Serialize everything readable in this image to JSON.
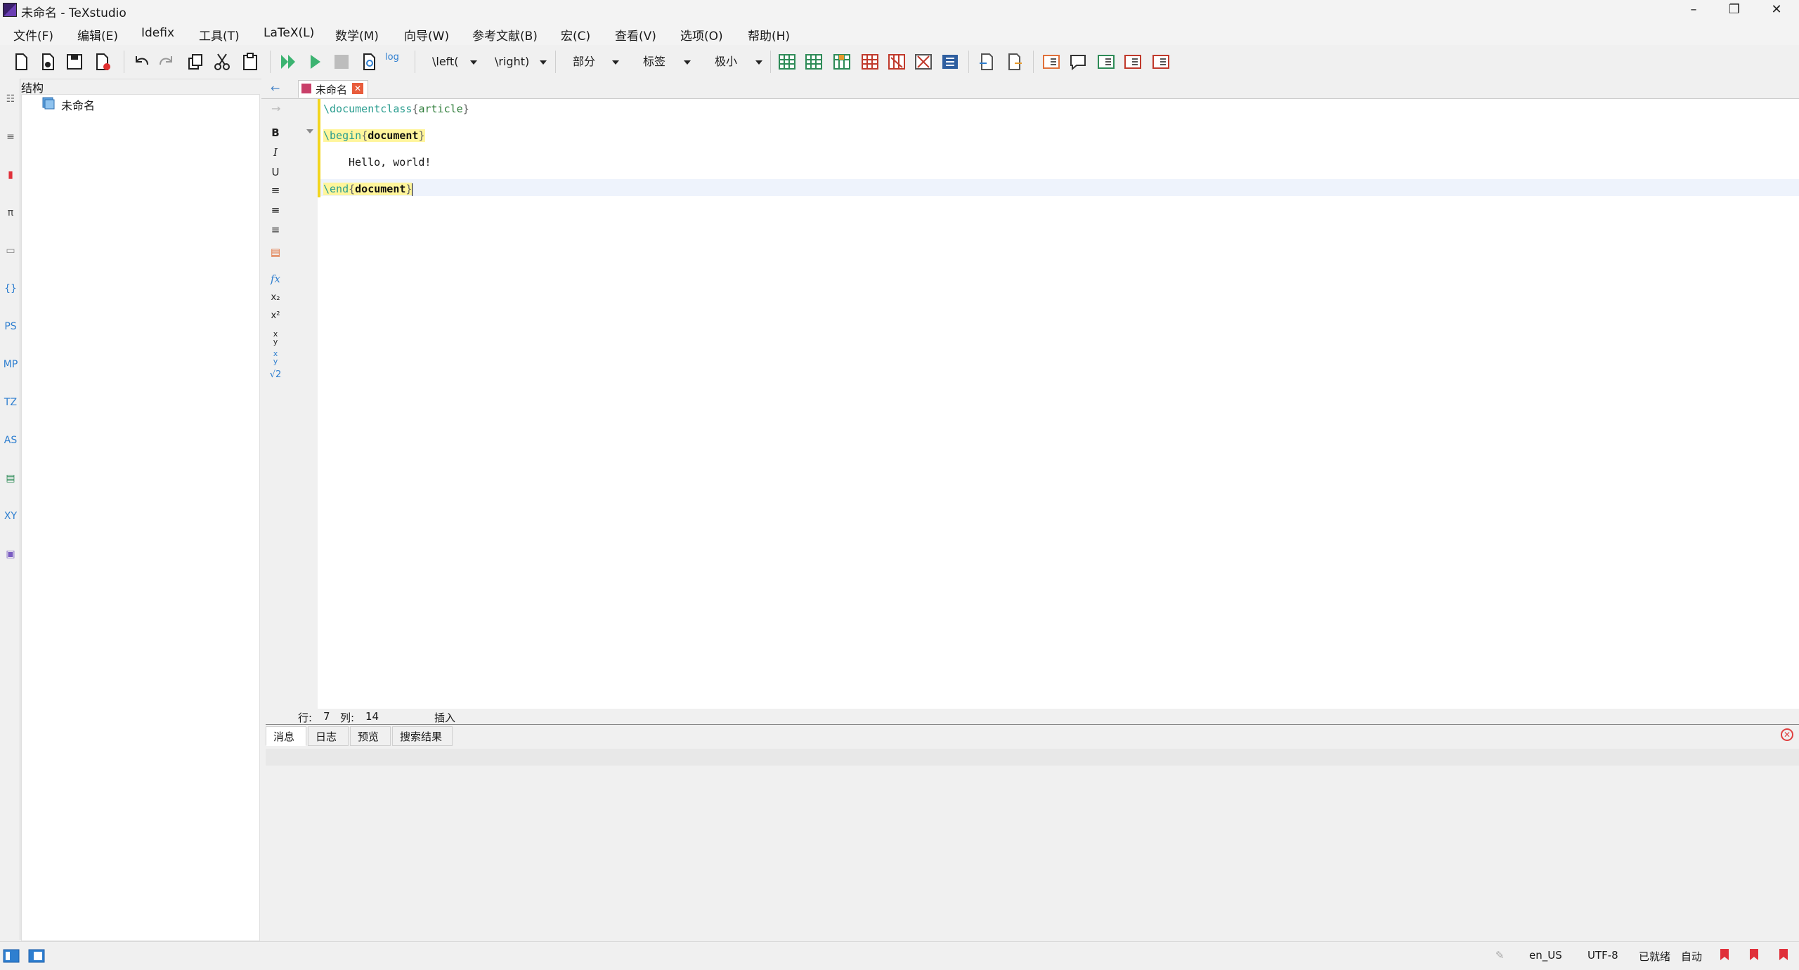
{
  "window": {
    "title": "未命名 - TeXstudio",
    "minimize": "–",
    "maximize": "❐",
    "close": "✕"
  },
  "menu": [
    {
      "label": "文件(F)"
    },
    {
      "label": "编辑(E)"
    },
    {
      "label": "Idefix"
    },
    {
      "label": "工具(T)"
    },
    {
      "label": "LaTeX(L)"
    },
    {
      "label": "数学(M)"
    },
    {
      "label": "向导(W)"
    },
    {
      "label": "参考文献(B)"
    },
    {
      "label": "宏(C)"
    },
    {
      "label": "查看(V)"
    },
    {
      "label": "选项(O)"
    },
    {
      "label": "帮助(H)"
    }
  ],
  "toolbar": {
    "left_delim": "\\left(",
    "right_delim": "\\right)",
    "section": "部分",
    "label": "标签",
    "size": "极小",
    "log_label": "log"
  },
  "structure": {
    "title": "结构",
    "root": "未命名"
  },
  "editor": {
    "tab_name": "未命名",
    "lines": {
      "l1_cmd": "\\documentclass",
      "l1_arg": "article",
      "l3_cmd": "\\begin",
      "l3_arg": "document",
      "l5_text": "Hello, world!",
      "l7_cmd": "\\end",
      "l7_arg": "document"
    }
  },
  "format_buttons": {
    "bold": "B",
    "italic": "I",
    "underline": "U"
  },
  "status": {
    "row_label": "行:",
    "row": "7",
    "col_label": "列:",
    "col": "14",
    "mode": "插入"
  },
  "messages": {
    "tabs": [
      "消息",
      "日志",
      "预览",
      "搜索结果"
    ]
  },
  "bottom": {
    "language": "en_US",
    "encoding": "UTF-8",
    "ready": "已就绪",
    "auto": "自动"
  },
  "left_icons": [
    "PS",
    "MP",
    "TZ",
    "AS",
    "XY"
  ],
  "colors": {
    "accent": "#2f7fd0",
    "highlight": "#fff59c",
    "keyword": "#2a9d8f",
    "bookmark": "#e0303a"
  }
}
